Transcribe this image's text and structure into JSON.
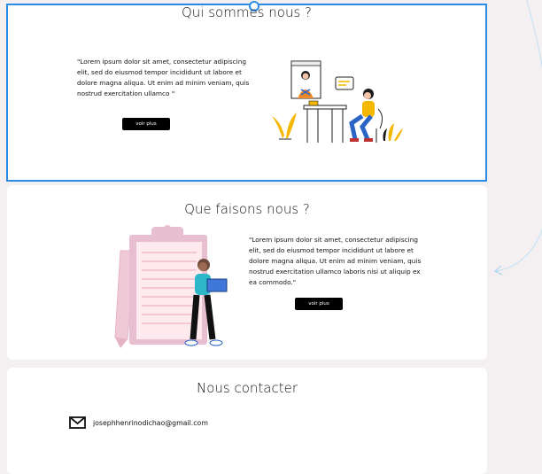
{
  "about": {
    "title": "Qui sommes nous ?",
    "text": "\"Lorem ipsum dolor sit amet, consectetur adipiscing elit, sed do eiusmod tempor incididunt ut labore et dolore magna aliqua. Ut enim ad minim veniam, quis nostrud exercitation ullamco \"",
    "button_label": "voir plus"
  },
  "services": {
    "title": "Que faisons nous ?",
    "text": "\"Lorem ipsum dolor sit amet, consectetur adipiscing elit, sed do eiusmod tempor incididunt ut labore et dolore magna aliqua. Ut enim ad minim veniam, quis nostrud exercitation ullamco laboris nisi ut aliquip ex ea commodo.\"",
    "button_label": "voir plus"
  },
  "contact": {
    "title": "Nous contacter",
    "email": "josephhenrinodichao@gmail.com",
    "email_icon": "mail-icon"
  },
  "colors": {
    "selection": "#2b8ce6",
    "page_bg": "#f4f0f1",
    "button_bg": "#000000",
    "accent_yellow": "#f5b800",
    "accent_pink": "#f0c9d6"
  }
}
